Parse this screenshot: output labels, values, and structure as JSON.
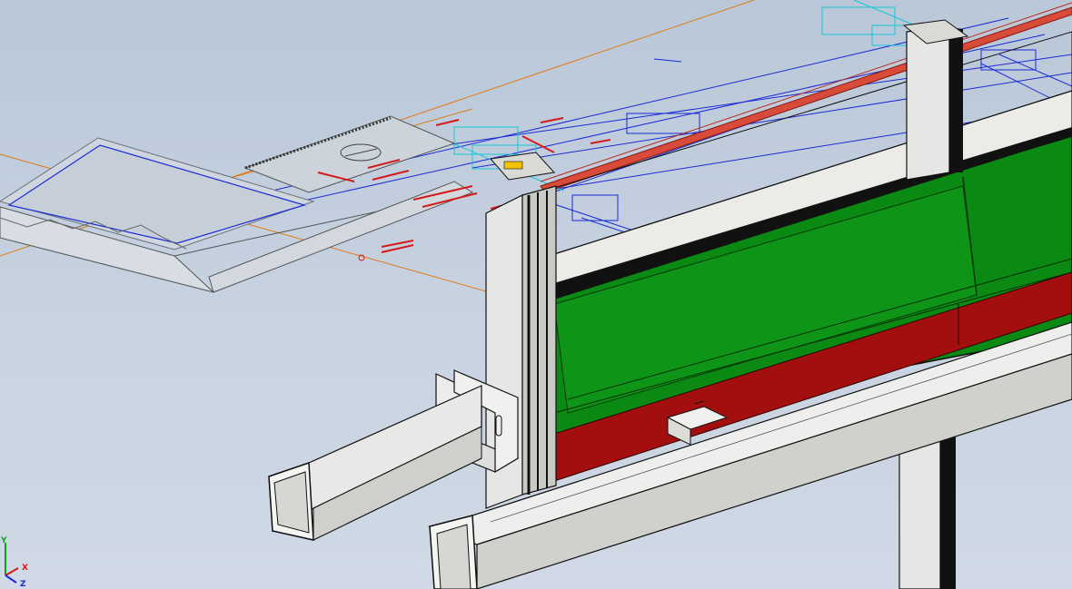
{
  "viewport": {
    "background_top": "#b9c7d8",
    "background_bottom": "#d0d9e5"
  },
  "colors": {
    "panel_green": "#0a8a12",
    "panel_red": "#a30f0f",
    "steel_light": "#e6e6e4",
    "steel_shade": "#c9c9c6",
    "sketch_blue": "#1a2bd6",
    "sketch_cyan": "#12c8d6",
    "sketch_orange": "#e07a12",
    "sketch_red": "#d41a1a",
    "edge_black": "#111111"
  },
  "triad": {
    "x_label": "X",
    "y_label": "Y",
    "z_label": "Z",
    "x_color": "#d41a1a",
    "y_color": "#12a01a",
    "z_color": "#1a2bd6"
  }
}
